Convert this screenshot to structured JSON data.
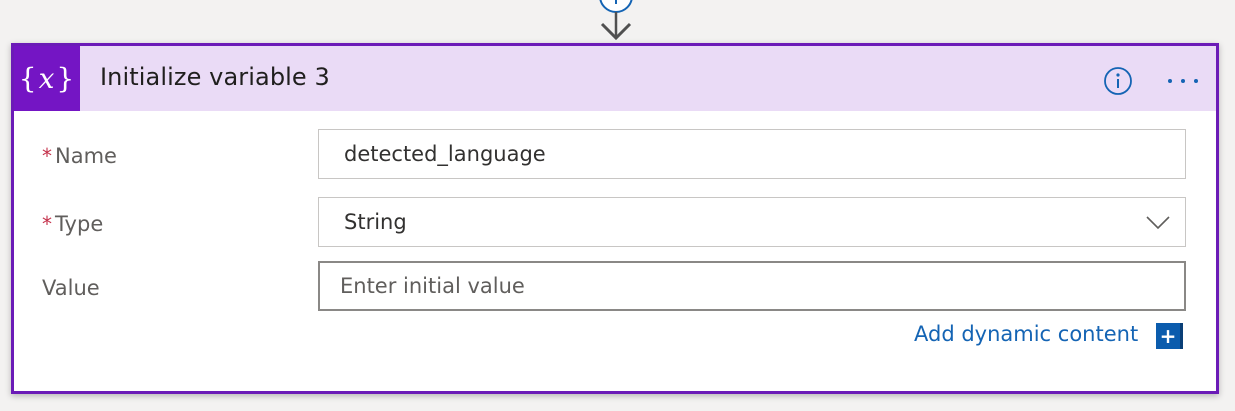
{
  "card": {
    "title": "Initialize variable 3",
    "icon": "variable-icon",
    "accent_color": "#6b1bb7",
    "header_bg": "#eadbf6"
  },
  "fields": {
    "name": {
      "label": "Name",
      "required_marker": "*",
      "value": "detected_language"
    },
    "type": {
      "label": "Type",
      "required_marker": "*",
      "value": "String"
    },
    "value": {
      "label": "Value",
      "placeholder": "Enter initial value"
    }
  },
  "dynamic_content": {
    "link_label": "Add dynamic content",
    "plus_label": "+"
  }
}
